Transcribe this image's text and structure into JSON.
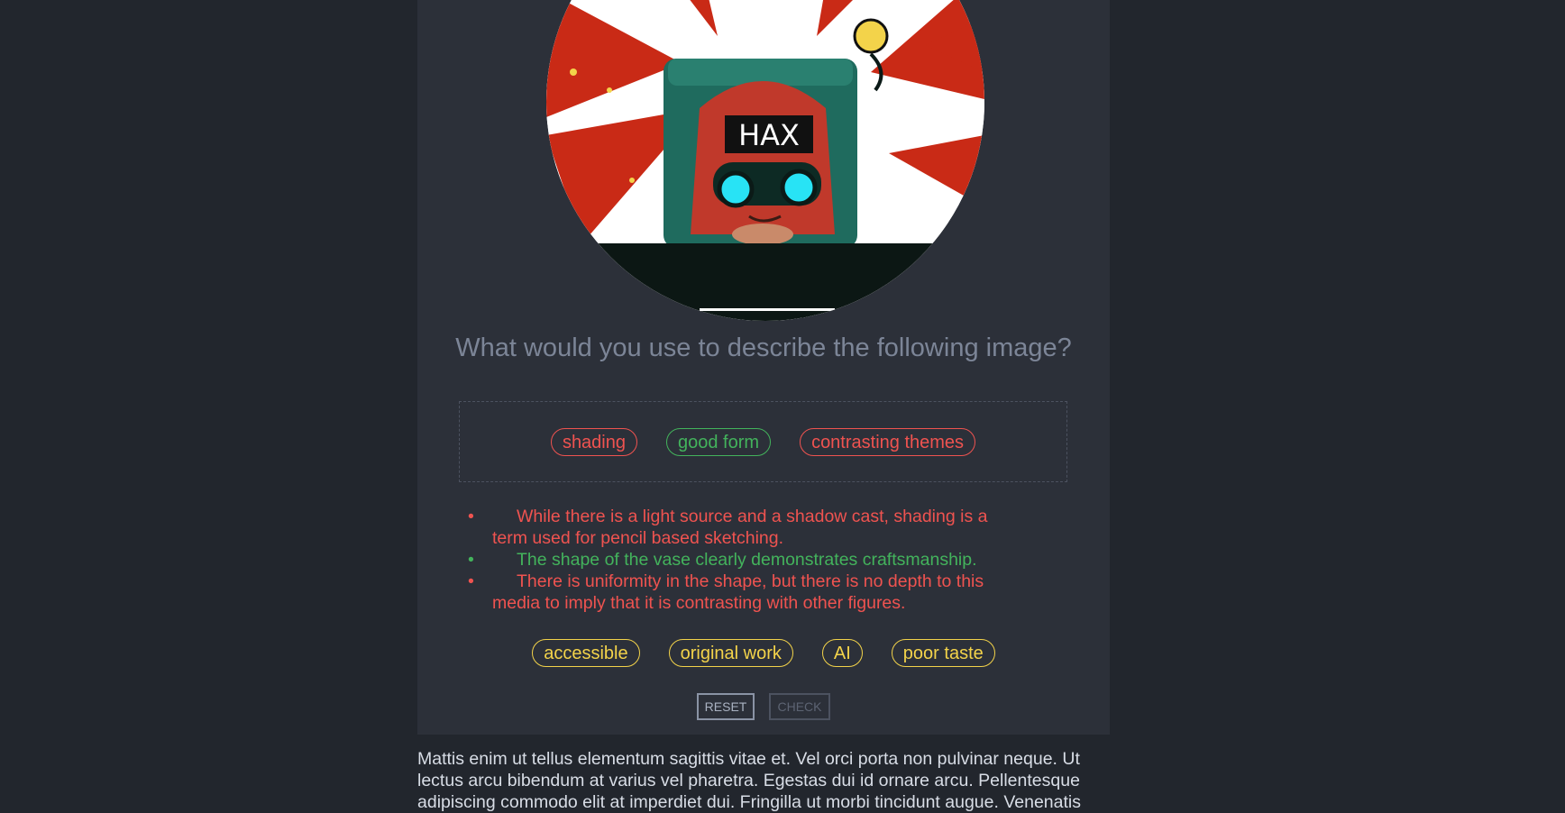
{
  "question": "What would you use to describe the following image?",
  "image": {
    "badge_text": "HAX"
  },
  "placed_answers": [
    {
      "label": "shading",
      "status": "incorrect"
    },
    {
      "label": "good form",
      "status": "correct"
    },
    {
      "label": "contrasting themes",
      "status": "incorrect"
    }
  ],
  "feedback": [
    {
      "text": "While there is a light source and a shadow cast, shading is a term used for pencil based sketching.",
      "status": "incorrect"
    },
    {
      "text": "The shape of the vase clearly demonstrates craftsmanship.",
      "status": "correct"
    },
    {
      "text": "There is uniformity in the shape, but there is no depth to this media to imply that it is contrasting with other figures.",
      "status": "incorrect"
    }
  ],
  "options": [
    "accessible",
    "original work",
    "AI",
    "poor taste"
  ],
  "buttons": {
    "reset": "RESET",
    "check": "CHECK"
  },
  "body_text": "Mattis enim ut tellus elementum sagittis vitae et. Vel orci porta non pulvinar neque. Ut lectus arcu bibendum at varius vel pharetra. Egestas dui id ornare arcu. Pellentesque adipiscing commodo elit at imperdiet dui. Fringilla ut morbi tincidunt augue. Venenatis",
  "colors": {
    "page_bg": "#22262d",
    "card_bg": "#2c3039",
    "incorrect": "#ef5350",
    "correct": "#43b35c",
    "option": "#f3d34a",
    "question_text": "#7c8597"
  }
}
